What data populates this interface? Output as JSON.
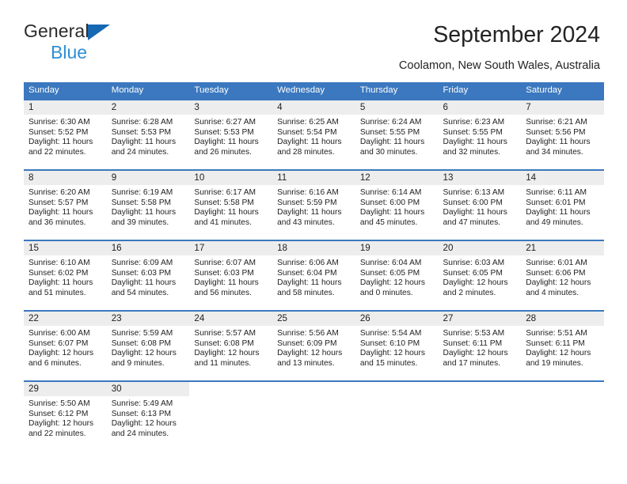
{
  "brand": {
    "line1": "General",
    "line2": "Blue",
    "triangle_icon": "brand-triangle-icon",
    "accent_dark": "#1668b3",
    "accent_light": "#2e8fd6"
  },
  "header": {
    "title": "September 2024",
    "subtitle": "Coolamon, New South Wales, Australia"
  },
  "colors": {
    "header_blue": "#3b78bf",
    "daynum_gray": "#ededed",
    "text": "#1f1f1f"
  },
  "calendar": {
    "weekday_headers": [
      "Sunday",
      "Monday",
      "Tuesday",
      "Wednesday",
      "Thursday",
      "Friday",
      "Saturday"
    ],
    "labels": {
      "sunrise": "Sunrise:",
      "sunset": "Sunset:",
      "daylight": "Daylight:"
    },
    "weeks": [
      [
        {
          "day": "1",
          "sunrise": "Sunrise: 6:30 AM",
          "sunset": "Sunset: 5:52 PM",
          "daylight_line1": "Daylight: 11 hours",
          "daylight_line2": "and 22 minutes."
        },
        {
          "day": "2",
          "sunrise": "Sunrise: 6:28 AM",
          "sunset": "Sunset: 5:53 PM",
          "daylight_line1": "Daylight: 11 hours",
          "daylight_line2": "and 24 minutes."
        },
        {
          "day": "3",
          "sunrise": "Sunrise: 6:27 AM",
          "sunset": "Sunset: 5:53 PM",
          "daylight_line1": "Daylight: 11 hours",
          "daylight_line2": "and 26 minutes."
        },
        {
          "day": "4",
          "sunrise": "Sunrise: 6:25 AM",
          "sunset": "Sunset: 5:54 PM",
          "daylight_line1": "Daylight: 11 hours",
          "daylight_line2": "and 28 minutes."
        },
        {
          "day": "5",
          "sunrise": "Sunrise: 6:24 AM",
          "sunset": "Sunset: 5:55 PM",
          "daylight_line1": "Daylight: 11 hours",
          "daylight_line2": "and 30 minutes."
        },
        {
          "day": "6",
          "sunrise": "Sunrise: 6:23 AM",
          "sunset": "Sunset: 5:55 PM",
          "daylight_line1": "Daylight: 11 hours",
          "daylight_line2": "and 32 minutes."
        },
        {
          "day": "7",
          "sunrise": "Sunrise: 6:21 AM",
          "sunset": "Sunset: 5:56 PM",
          "daylight_line1": "Daylight: 11 hours",
          "daylight_line2": "and 34 minutes."
        }
      ],
      [
        {
          "day": "8",
          "sunrise": "Sunrise: 6:20 AM",
          "sunset": "Sunset: 5:57 PM",
          "daylight_line1": "Daylight: 11 hours",
          "daylight_line2": "and 36 minutes."
        },
        {
          "day": "9",
          "sunrise": "Sunrise: 6:19 AM",
          "sunset": "Sunset: 5:58 PM",
          "daylight_line1": "Daylight: 11 hours",
          "daylight_line2": "and 39 minutes."
        },
        {
          "day": "10",
          "sunrise": "Sunrise: 6:17 AM",
          "sunset": "Sunset: 5:58 PM",
          "daylight_line1": "Daylight: 11 hours",
          "daylight_line2": "and 41 minutes."
        },
        {
          "day": "11",
          "sunrise": "Sunrise: 6:16 AM",
          "sunset": "Sunset: 5:59 PM",
          "daylight_line1": "Daylight: 11 hours",
          "daylight_line2": "and 43 minutes."
        },
        {
          "day": "12",
          "sunrise": "Sunrise: 6:14 AM",
          "sunset": "Sunset: 6:00 PM",
          "daylight_line1": "Daylight: 11 hours",
          "daylight_line2": "and 45 minutes."
        },
        {
          "day": "13",
          "sunrise": "Sunrise: 6:13 AM",
          "sunset": "Sunset: 6:00 PM",
          "daylight_line1": "Daylight: 11 hours",
          "daylight_line2": "and 47 minutes."
        },
        {
          "day": "14",
          "sunrise": "Sunrise: 6:11 AM",
          "sunset": "Sunset: 6:01 PM",
          "daylight_line1": "Daylight: 11 hours",
          "daylight_line2": "and 49 minutes."
        }
      ],
      [
        {
          "day": "15",
          "sunrise": "Sunrise: 6:10 AM",
          "sunset": "Sunset: 6:02 PM",
          "daylight_line1": "Daylight: 11 hours",
          "daylight_line2": "and 51 minutes."
        },
        {
          "day": "16",
          "sunrise": "Sunrise: 6:09 AM",
          "sunset": "Sunset: 6:03 PM",
          "daylight_line1": "Daylight: 11 hours",
          "daylight_line2": "and 54 minutes."
        },
        {
          "day": "17",
          "sunrise": "Sunrise: 6:07 AM",
          "sunset": "Sunset: 6:03 PM",
          "daylight_line1": "Daylight: 11 hours",
          "daylight_line2": "and 56 minutes."
        },
        {
          "day": "18",
          "sunrise": "Sunrise: 6:06 AM",
          "sunset": "Sunset: 6:04 PM",
          "daylight_line1": "Daylight: 11 hours",
          "daylight_line2": "and 58 minutes."
        },
        {
          "day": "19",
          "sunrise": "Sunrise: 6:04 AM",
          "sunset": "Sunset: 6:05 PM",
          "daylight_line1": "Daylight: 12 hours",
          "daylight_line2": "and 0 minutes."
        },
        {
          "day": "20",
          "sunrise": "Sunrise: 6:03 AM",
          "sunset": "Sunset: 6:05 PM",
          "daylight_line1": "Daylight: 12 hours",
          "daylight_line2": "and 2 minutes."
        },
        {
          "day": "21",
          "sunrise": "Sunrise: 6:01 AM",
          "sunset": "Sunset: 6:06 PM",
          "daylight_line1": "Daylight: 12 hours",
          "daylight_line2": "and 4 minutes."
        }
      ],
      [
        {
          "day": "22",
          "sunrise": "Sunrise: 6:00 AM",
          "sunset": "Sunset: 6:07 PM",
          "daylight_line1": "Daylight: 12 hours",
          "daylight_line2": "and 6 minutes."
        },
        {
          "day": "23",
          "sunrise": "Sunrise: 5:59 AM",
          "sunset": "Sunset: 6:08 PM",
          "daylight_line1": "Daylight: 12 hours",
          "daylight_line2": "and 9 minutes."
        },
        {
          "day": "24",
          "sunrise": "Sunrise: 5:57 AM",
          "sunset": "Sunset: 6:08 PM",
          "daylight_line1": "Daylight: 12 hours",
          "daylight_line2": "and 11 minutes."
        },
        {
          "day": "25",
          "sunrise": "Sunrise: 5:56 AM",
          "sunset": "Sunset: 6:09 PM",
          "daylight_line1": "Daylight: 12 hours",
          "daylight_line2": "and 13 minutes."
        },
        {
          "day": "26",
          "sunrise": "Sunrise: 5:54 AM",
          "sunset": "Sunset: 6:10 PM",
          "daylight_line1": "Daylight: 12 hours",
          "daylight_line2": "and 15 minutes."
        },
        {
          "day": "27",
          "sunrise": "Sunrise: 5:53 AM",
          "sunset": "Sunset: 6:11 PM",
          "daylight_line1": "Daylight: 12 hours",
          "daylight_line2": "and 17 minutes."
        },
        {
          "day": "28",
          "sunrise": "Sunrise: 5:51 AM",
          "sunset": "Sunset: 6:11 PM",
          "daylight_line1": "Daylight: 12 hours",
          "daylight_line2": "and 19 minutes."
        }
      ],
      [
        {
          "day": "29",
          "sunrise": "Sunrise: 5:50 AM",
          "sunset": "Sunset: 6:12 PM",
          "daylight_line1": "Daylight: 12 hours",
          "daylight_line2": "and 22 minutes."
        },
        {
          "day": "30",
          "sunrise": "Sunrise: 5:49 AM",
          "sunset": "Sunset: 6:13 PM",
          "daylight_line1": "Daylight: 12 hours",
          "daylight_line2": "and 24 minutes."
        },
        {
          "day": "",
          "sunrise": "",
          "sunset": "",
          "daylight_line1": "",
          "daylight_line2": ""
        },
        {
          "day": "",
          "sunrise": "",
          "sunset": "",
          "daylight_line1": "",
          "daylight_line2": ""
        },
        {
          "day": "",
          "sunrise": "",
          "sunset": "",
          "daylight_line1": "",
          "daylight_line2": ""
        },
        {
          "day": "",
          "sunrise": "",
          "sunset": "",
          "daylight_line1": "",
          "daylight_line2": ""
        },
        {
          "day": "",
          "sunrise": "",
          "sunset": "",
          "daylight_line1": "",
          "daylight_line2": ""
        }
      ]
    ]
  }
}
